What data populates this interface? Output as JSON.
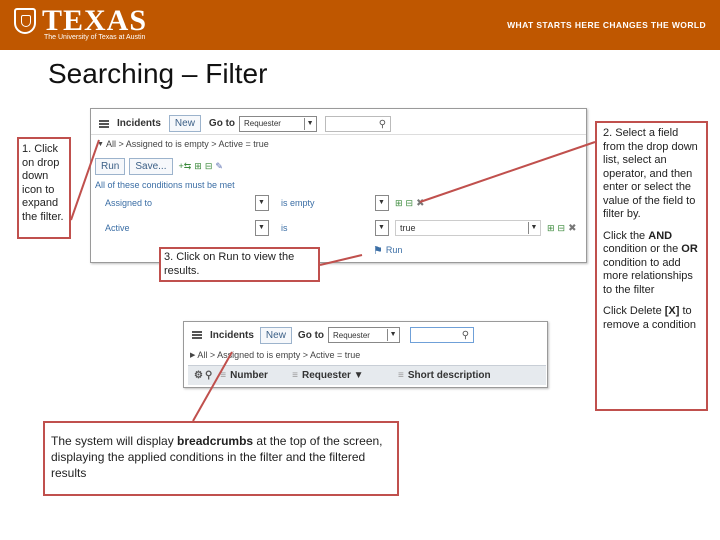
{
  "header": {
    "logo_text": "TEXAS",
    "logo_sub": "The University of Texas at Austin",
    "tagline": "WHAT STARTS HERE CHANGES THE WORLD"
  },
  "title": "Searching – Filter",
  "shot1": {
    "tab_label": "Incidents",
    "new_label": "New",
    "goto_label": "Go to",
    "goto_value": "Requester",
    "breadcrumb": "All > Assigned to is empty > Active = true",
    "run_label": "Run",
    "save_label": "Save...",
    "all_conditions": "All of these conditions must be met",
    "conditions": [
      {
        "field": "Assigned to",
        "operator": "is empty",
        "value": ""
      },
      {
        "field": "Active",
        "operator": "is",
        "value": "true"
      }
    ],
    "run_link": "Run"
  },
  "shot2": {
    "tab_label": "Incidents",
    "new_label": "New",
    "goto_label": "Go to",
    "goto_value": "Requester",
    "breadcrumb": "All > Assigned to is empty > Active = true",
    "columns": [
      "Number",
      "Requester ▼",
      "Short description"
    ]
  },
  "callouts": {
    "c1": "1. Click on drop down icon to expand the filter.",
    "c2_p1": "2. Select a field from the drop down list, select an operator, and then enter or select the value of the field  to filter by.",
    "c2_p2_pre": "Click the ",
    "c2_p2_and": "AND",
    "c2_p2_mid": " condition or the ",
    "c2_p2_or": "OR",
    "c2_p2_post": " condition to add more relationships to the filter",
    "c2_p3_pre": "Click Delete ",
    "c2_p3_x": "[X]",
    "c2_p3_post": " to remove a condition",
    "c3": "3. Click on Run to view the results.",
    "c4_pre": "The system will display ",
    "c4_bold": "breadcrumbs",
    "c4_post": " at the top of the screen, displaying the applied conditions in the filter and the filtered results"
  },
  "colors": {
    "brand": "#bf5700",
    "callout_border": "#c0504d",
    "link": "#3b6ea5"
  }
}
